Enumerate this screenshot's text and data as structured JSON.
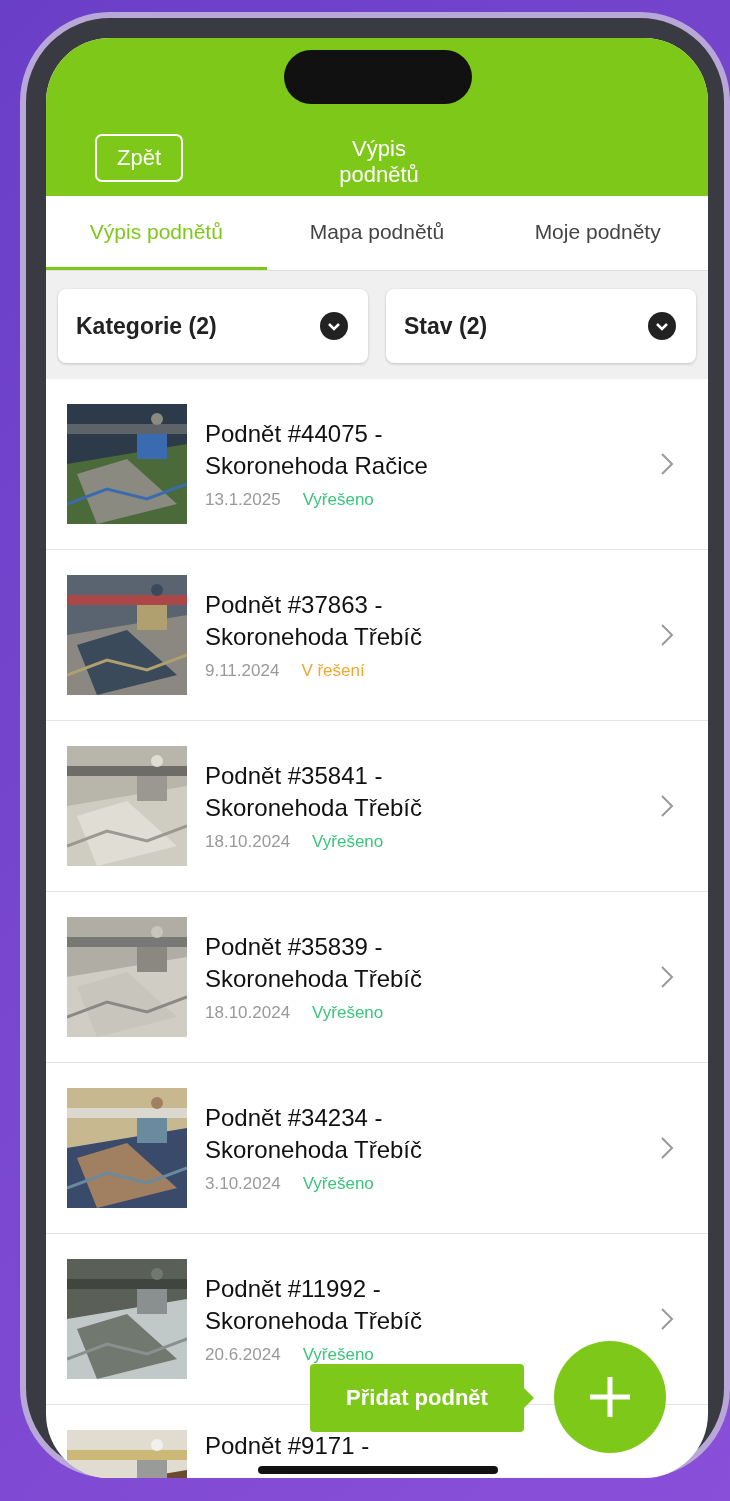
{
  "header": {
    "back_button": "Zpět",
    "title": "Výpis podnětů"
  },
  "tabs": [
    {
      "label": "Výpis podnětů",
      "selected": true
    },
    {
      "label": "Mapa podnětů",
      "selected": false
    },
    {
      "label": "Moje podněty",
      "selected": false
    }
  ],
  "filters": [
    {
      "label": "Kategorie (2)"
    },
    {
      "label": "Stav (2)"
    }
  ],
  "items": [
    {
      "title": "Podnět #44075 -",
      "subtitle": "Skoronehoda Račice",
      "date": "13.1.2025",
      "status": "Vyřešeno",
      "color": "#3cc47c"
    },
    {
      "title": "Podnět #37863 -",
      "subtitle": "Skoronehoda Třebíč",
      "date": "9.11.2024",
      "status": "V řešení",
      "color": "#f0a830"
    },
    {
      "title": "Podnět #35841 -",
      "subtitle": "Skoronehoda Třebíč",
      "date": "18.10.2024",
      "status": "Vyřešeno",
      "color": "#3cc47c"
    },
    {
      "title": "Podnět #35839 -",
      "subtitle": "Skoronehoda Třebíč",
      "date": "18.10.2024",
      "status": "Vyřešeno",
      "color": "#3cc47c"
    },
    {
      "title": "Podnět #34234 -",
      "subtitle": "Skoronehoda Třebíč",
      "date": "3.10.2024",
      "status": "Vyřešeno",
      "color": "#3cc47c"
    },
    {
      "title": "Podnět #11992 -",
      "subtitle": "Skoronehoda Třebíč",
      "date": "20.6.2024",
      "status": "Vyřešeno",
      "color": "#3cc47c"
    },
    {
      "title": "Podnět #9171 -"
    }
  ],
  "add_button": {
    "label": "Přidat podnět"
  }
}
